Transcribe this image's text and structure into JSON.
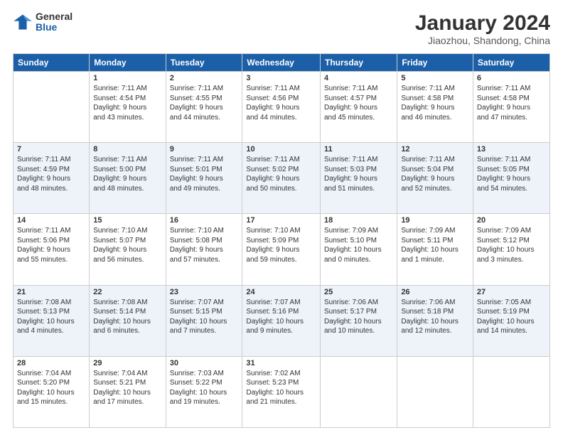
{
  "header": {
    "logo": {
      "general": "General",
      "blue": "Blue"
    },
    "title": "January 2024",
    "location": "Jiaozhou, Shandong, China"
  },
  "weekdays": [
    "Sunday",
    "Monday",
    "Tuesday",
    "Wednesday",
    "Thursday",
    "Friday",
    "Saturday"
  ],
  "weeks": [
    [
      {
        "day": "",
        "text": ""
      },
      {
        "day": "1",
        "text": "Sunrise: 7:11 AM\nSunset: 4:54 PM\nDaylight: 9 hours\nand 43 minutes."
      },
      {
        "day": "2",
        "text": "Sunrise: 7:11 AM\nSunset: 4:55 PM\nDaylight: 9 hours\nand 44 minutes."
      },
      {
        "day": "3",
        "text": "Sunrise: 7:11 AM\nSunset: 4:56 PM\nDaylight: 9 hours\nand 44 minutes."
      },
      {
        "day": "4",
        "text": "Sunrise: 7:11 AM\nSunset: 4:57 PM\nDaylight: 9 hours\nand 45 minutes."
      },
      {
        "day": "5",
        "text": "Sunrise: 7:11 AM\nSunset: 4:58 PM\nDaylight: 9 hours\nand 46 minutes."
      },
      {
        "day": "6",
        "text": "Sunrise: 7:11 AM\nSunset: 4:58 PM\nDaylight: 9 hours\nand 47 minutes."
      }
    ],
    [
      {
        "day": "7",
        "text": "Sunrise: 7:11 AM\nSunset: 4:59 PM\nDaylight: 9 hours\nand 48 minutes."
      },
      {
        "day": "8",
        "text": "Sunrise: 7:11 AM\nSunset: 5:00 PM\nDaylight: 9 hours\nand 48 minutes."
      },
      {
        "day": "9",
        "text": "Sunrise: 7:11 AM\nSunset: 5:01 PM\nDaylight: 9 hours\nand 49 minutes."
      },
      {
        "day": "10",
        "text": "Sunrise: 7:11 AM\nSunset: 5:02 PM\nDaylight: 9 hours\nand 50 minutes."
      },
      {
        "day": "11",
        "text": "Sunrise: 7:11 AM\nSunset: 5:03 PM\nDaylight: 9 hours\nand 51 minutes."
      },
      {
        "day": "12",
        "text": "Sunrise: 7:11 AM\nSunset: 5:04 PM\nDaylight: 9 hours\nand 52 minutes."
      },
      {
        "day": "13",
        "text": "Sunrise: 7:11 AM\nSunset: 5:05 PM\nDaylight: 9 hours\nand 54 minutes."
      }
    ],
    [
      {
        "day": "14",
        "text": "Sunrise: 7:11 AM\nSunset: 5:06 PM\nDaylight: 9 hours\nand 55 minutes."
      },
      {
        "day": "15",
        "text": "Sunrise: 7:10 AM\nSunset: 5:07 PM\nDaylight: 9 hours\nand 56 minutes."
      },
      {
        "day": "16",
        "text": "Sunrise: 7:10 AM\nSunset: 5:08 PM\nDaylight: 9 hours\nand 57 minutes."
      },
      {
        "day": "17",
        "text": "Sunrise: 7:10 AM\nSunset: 5:09 PM\nDaylight: 9 hours\nand 59 minutes."
      },
      {
        "day": "18",
        "text": "Sunrise: 7:09 AM\nSunset: 5:10 PM\nDaylight: 10 hours\nand 0 minutes."
      },
      {
        "day": "19",
        "text": "Sunrise: 7:09 AM\nSunset: 5:11 PM\nDaylight: 10 hours\nand 1 minute."
      },
      {
        "day": "20",
        "text": "Sunrise: 7:09 AM\nSunset: 5:12 PM\nDaylight: 10 hours\nand 3 minutes."
      }
    ],
    [
      {
        "day": "21",
        "text": "Sunrise: 7:08 AM\nSunset: 5:13 PM\nDaylight: 10 hours\nand 4 minutes."
      },
      {
        "day": "22",
        "text": "Sunrise: 7:08 AM\nSunset: 5:14 PM\nDaylight: 10 hours\nand 6 minutes."
      },
      {
        "day": "23",
        "text": "Sunrise: 7:07 AM\nSunset: 5:15 PM\nDaylight: 10 hours\nand 7 minutes."
      },
      {
        "day": "24",
        "text": "Sunrise: 7:07 AM\nSunset: 5:16 PM\nDaylight: 10 hours\nand 9 minutes."
      },
      {
        "day": "25",
        "text": "Sunrise: 7:06 AM\nSunset: 5:17 PM\nDaylight: 10 hours\nand 10 minutes."
      },
      {
        "day": "26",
        "text": "Sunrise: 7:06 AM\nSunset: 5:18 PM\nDaylight: 10 hours\nand 12 minutes."
      },
      {
        "day": "27",
        "text": "Sunrise: 7:05 AM\nSunset: 5:19 PM\nDaylight: 10 hours\nand 14 minutes."
      }
    ],
    [
      {
        "day": "28",
        "text": "Sunrise: 7:04 AM\nSunset: 5:20 PM\nDaylight: 10 hours\nand 15 minutes."
      },
      {
        "day": "29",
        "text": "Sunrise: 7:04 AM\nSunset: 5:21 PM\nDaylight: 10 hours\nand 17 minutes."
      },
      {
        "day": "30",
        "text": "Sunrise: 7:03 AM\nSunset: 5:22 PM\nDaylight: 10 hours\nand 19 minutes."
      },
      {
        "day": "31",
        "text": "Sunrise: 7:02 AM\nSunset: 5:23 PM\nDaylight: 10 hours\nand 21 minutes."
      },
      {
        "day": "",
        "text": ""
      },
      {
        "day": "",
        "text": ""
      },
      {
        "day": "",
        "text": ""
      }
    ]
  ]
}
